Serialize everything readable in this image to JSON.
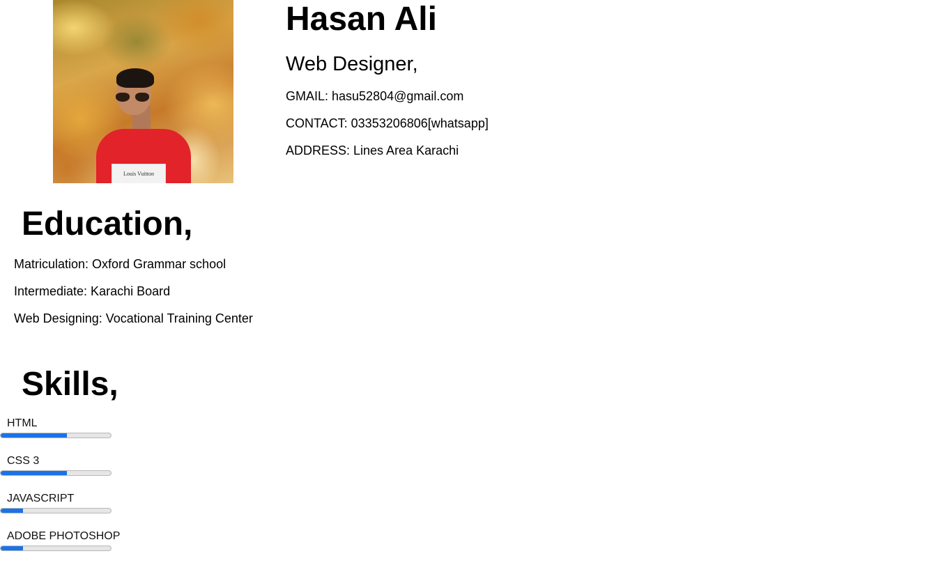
{
  "profile": {
    "photo_icon": "profile-photo",
    "shirt_print": "Louis Vuitton",
    "name": "Hasan Ali",
    "title": "Web Designer,",
    "gmail": "GMAIL: hasu52804@gmail.com",
    "contact": "CONTACT: 03353206806[whatsapp]",
    "address": "ADDRESS: Lines Area Karachi"
  },
  "education": {
    "heading": "Education,",
    "items": [
      "Matriculation: Oxford Grammar school",
      "Intermediate: Karachi Board",
      "Web Designing: Vocational Training Center"
    ]
  },
  "skills": {
    "heading": "Skills,",
    "accent_color": "#1a73e8",
    "items": [
      {
        "label": "HTML",
        "level": 0.6
      },
      {
        "label": "CSS 3",
        "level": 0.6
      },
      {
        "label": "JAVASCRIPT",
        "level": 0.2
      },
      {
        "label": "ADOBE PHOTOSHOP",
        "level": 0.2
      }
    ]
  }
}
